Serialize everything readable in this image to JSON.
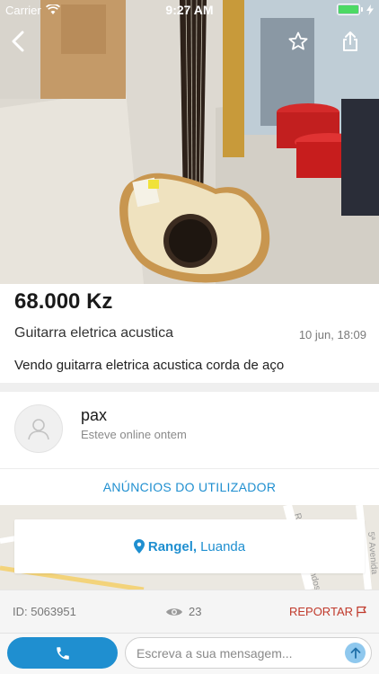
{
  "status_bar": {
    "carrier": "Carrier",
    "time": "9:27 AM",
    "battery_level": 1.0
  },
  "listing": {
    "price": "68.000 Kz",
    "title": "Guitarra eletrica acustica",
    "date": "10 jun, 18:09",
    "description": "Vendo guitarra eletrica acustica corda de aço"
  },
  "seller": {
    "name": "pax",
    "status": "Esteve online ontem",
    "ads_link": "ANÚNCIOS DO UTILIZADOR"
  },
  "location": {
    "area": "Rangel,",
    "city": "Luanda"
  },
  "info": {
    "id_label": "ID: 5063951",
    "views": "23",
    "report_label": "REPORTAR"
  },
  "message": {
    "placeholder": "Escreva a sua mensagem..."
  },
  "icons": {
    "back": "chevron-left-icon",
    "favorite": "star-icon",
    "share": "share-icon",
    "avatar": "user-icon",
    "location": "map-pin-icon",
    "views": "eye-icon",
    "report": "flag-icon",
    "call": "phone-icon",
    "send": "arrow-up-icon"
  },
  "colors": {
    "accent": "#1f8fd0",
    "report": "#c0392b",
    "battery": "#4cd964"
  }
}
